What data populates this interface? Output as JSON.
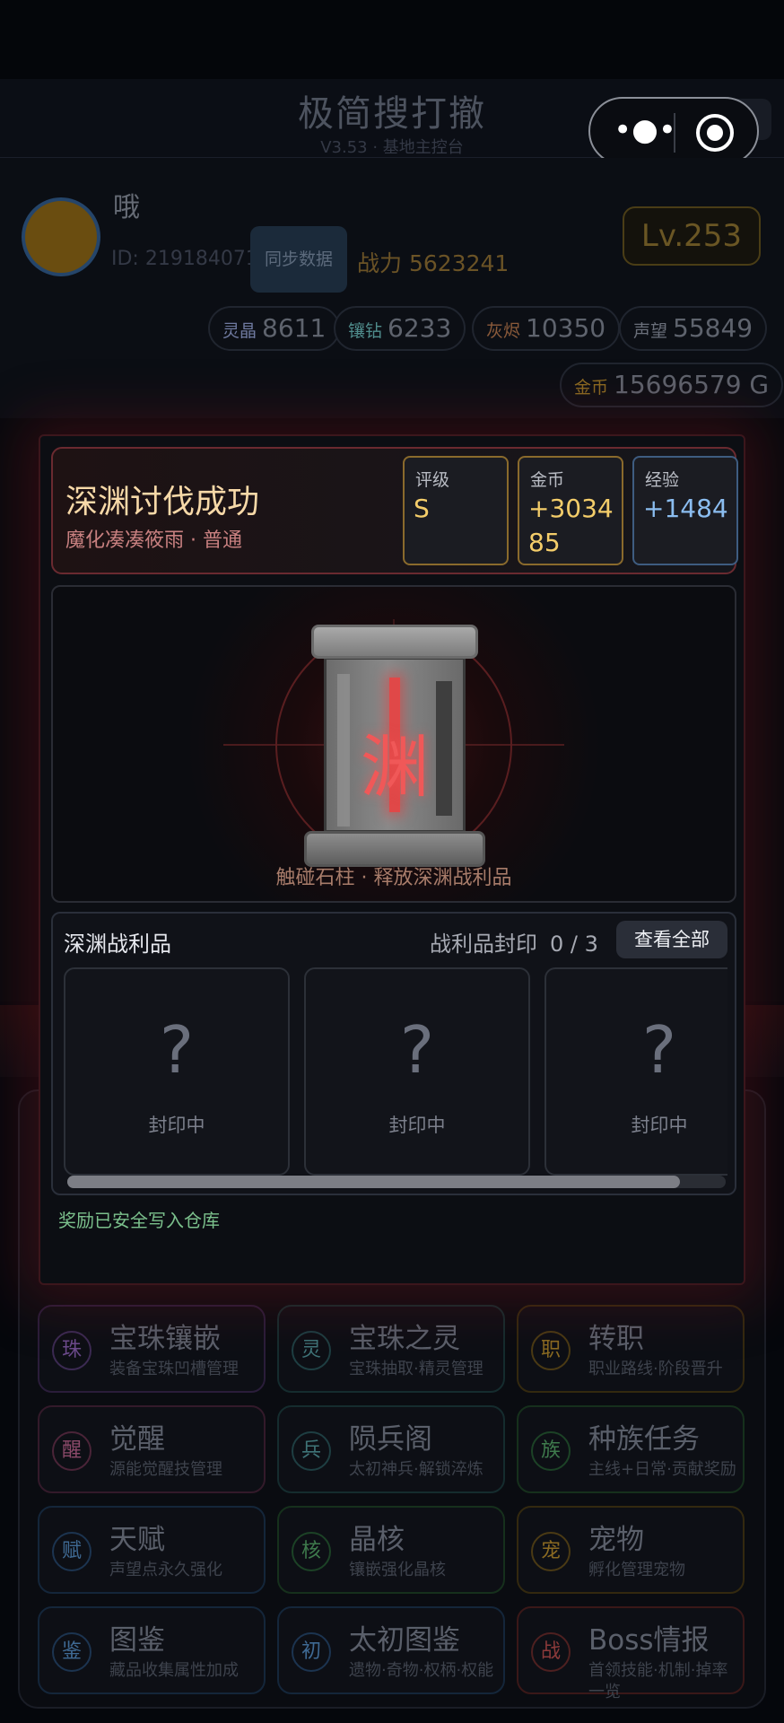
{
  "app": {
    "title": "极简搜打撤",
    "version": "V3.53",
    "subtitle": "基地主控台"
  },
  "capsule": {
    "more": "•●•"
  },
  "player": {
    "name": "哦",
    "id": "ID: 219184071",
    "sync_label": "同步数据",
    "power": "战力 5623241",
    "level": "Lv.253"
  },
  "resources": [
    {
      "key": "灵晶",
      "value": "8611",
      "color": "#6f7aa0"
    },
    {
      "key": "镶钻",
      "value": "6233",
      "color": "#4f8c8c"
    },
    {
      "key": "灰烬",
      "value": "10350",
      "color": "#8a5a3a"
    },
    {
      "key": "声望",
      "value": "55849",
      "color": "#6a6f7a"
    },
    {
      "key": "金币",
      "value": "15696579 G",
      "color": "#8a6a22"
    }
  ],
  "result": {
    "title": "深渊讨伐成功",
    "subtitle": "魔化凑凑筱雨 · 普通",
    "grade_label": "评级",
    "grade": "S",
    "gold_label": "金币",
    "gold": "+303485",
    "exp_label": "经验",
    "exp": "+1484"
  },
  "pillar": {
    "glyph": "渊",
    "hint": "触碰石柱 · 释放深渊战利品"
  },
  "loot": {
    "title": "深渊战利品",
    "seal_label": "战利品封印",
    "seal_count": "0 / 3",
    "view_all": "查看全部",
    "slots": [
      {
        "mark": "?",
        "status": "封印中"
      },
      {
        "mark": "?",
        "status": "封印中"
      },
      {
        "mark": "?",
        "status": "封印中"
      }
    ],
    "scroll_fraction": 0.93
  },
  "footer_note": "奖励已安全写入仓库",
  "menu": [
    {
      "badge": "珠",
      "title": "宝珠镶嵌",
      "desc": "装备宝珠凹槽管理",
      "theme": "purple"
    },
    {
      "badge": "灵",
      "title": "宝珠之灵",
      "desc": "宝珠抽取·精灵管理",
      "theme": "teal"
    },
    {
      "badge": "职",
      "title": "转职",
      "desc": "职业路线·阶段晋升",
      "theme": "gold"
    },
    {
      "badge": "醒",
      "title": "觉醒",
      "desc": "源能觉醒技管理",
      "theme": "pink"
    },
    {
      "badge": "兵",
      "title": "陨兵阁",
      "desc": "太初神兵·解锁淬炼",
      "theme": "teal"
    },
    {
      "badge": "族",
      "title": "种族任务",
      "desc": "主线+日常·贡献奖励",
      "theme": "green"
    },
    {
      "badge": "赋",
      "title": "天赋",
      "desc": "声望点永久强化",
      "theme": "blue"
    },
    {
      "badge": "核",
      "title": "晶核",
      "desc": "镶嵌强化晶核",
      "theme": "green"
    },
    {
      "badge": "宠",
      "title": "宠物",
      "desc": "孵化管理宠物",
      "theme": "gold"
    },
    {
      "badge": "鉴",
      "title": "图鉴",
      "desc": "藏品收集属性加成",
      "theme": "blue"
    },
    {
      "badge": "初",
      "title": "太初图鉴",
      "desc": "遗物·奇物·权柄·权能",
      "theme": "blue"
    },
    {
      "badge": "战",
      "title": "Boss情报",
      "desc": "首领技能·机制·掉率一览",
      "theme": "red"
    }
  ],
  "partial_text": "天赋"
}
